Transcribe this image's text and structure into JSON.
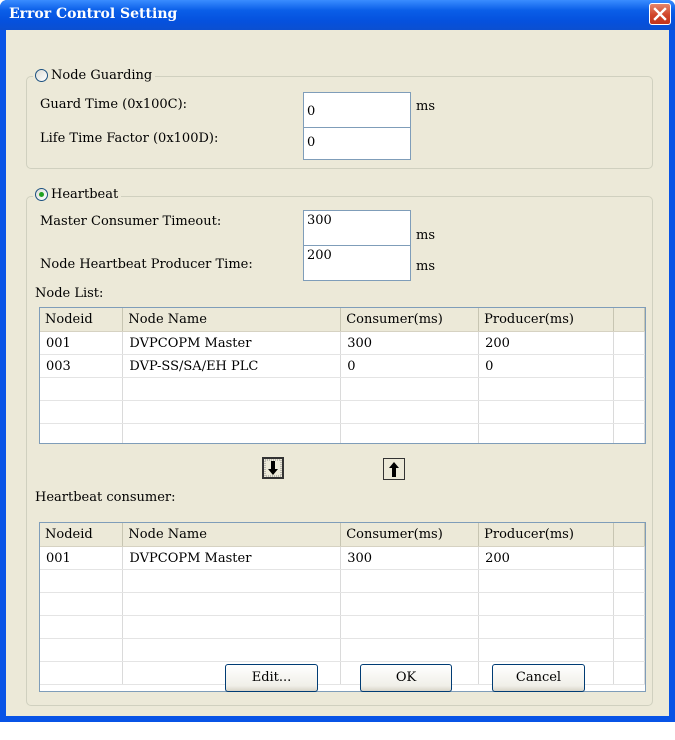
{
  "window": {
    "title": "Error Control Setting"
  },
  "node_guarding": {
    "label": "Node Guarding",
    "selected": false,
    "guard_time": {
      "label": "Guard Time (0x100C):",
      "value": "0",
      "unit": "ms"
    },
    "life_time_factor": {
      "label": "Life Time Factor (0x100D):",
      "value": "0"
    }
  },
  "heartbeat": {
    "label": "Heartbeat",
    "selected": true,
    "master_consumer_timeout": {
      "label": "Master Consumer Timeout:",
      "value": "300",
      "unit": "ms"
    },
    "node_producer_time": {
      "label": "Node Heartbeat Producer Time:",
      "value": "200",
      "unit": "ms"
    },
    "node_list": {
      "label": "Node List:",
      "columns": [
        "Nodeid",
        "Node Name",
        "Consumer(ms)",
        "Producer(ms)"
      ],
      "rows": [
        [
          "001",
          "DVPCOPM Master",
          "300",
          "200"
        ],
        [
          "003",
          "DVP-SS/SA/EH PLC",
          "0",
          "0"
        ]
      ]
    },
    "consumer_list": {
      "label": "Heartbeat consumer:",
      "columns": [
        "Nodeid",
        "Node Name",
        "Consumer(ms)",
        "Producer(ms)"
      ],
      "rows": [
        [
          "001",
          "DVPCOPM Master",
          "300",
          "200"
        ]
      ]
    }
  },
  "buttons": {
    "edit": "Edit...",
    "ok": "OK",
    "cancel": "Cancel"
  },
  "icons": {
    "close": "close-icon",
    "move_down": "arrow-down-icon",
    "move_up": "arrow-up-icon"
  }
}
